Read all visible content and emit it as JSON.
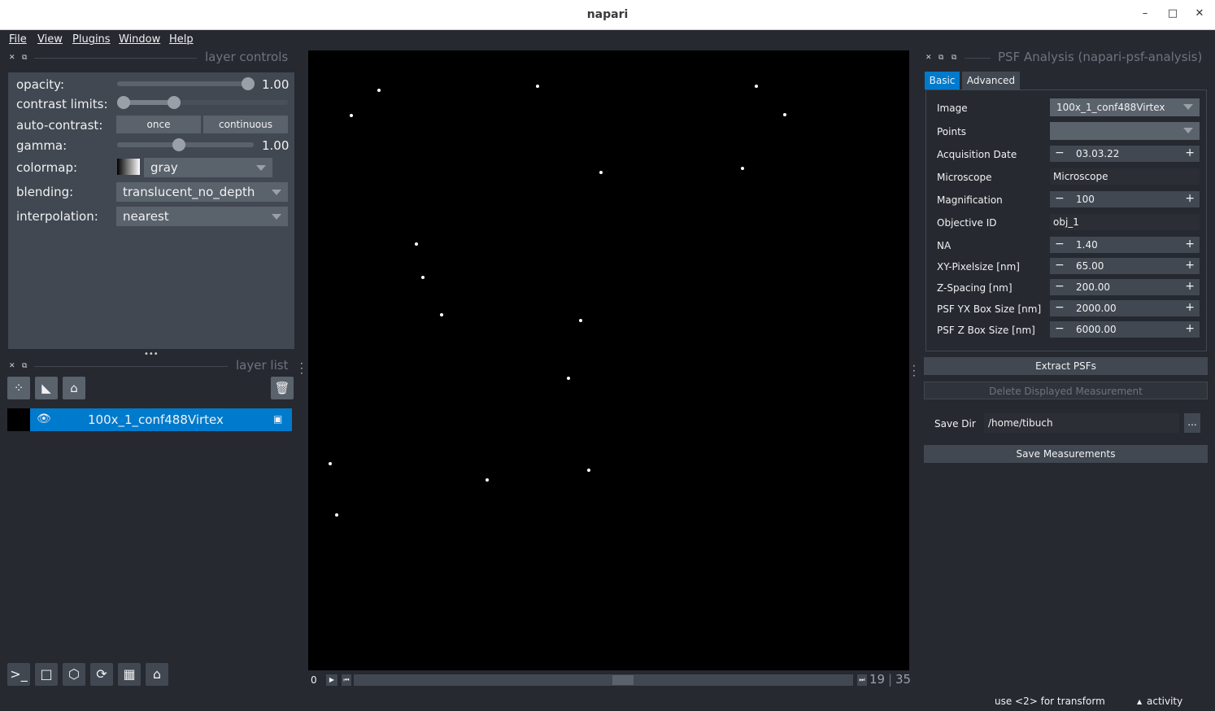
{
  "window": {
    "title": "napari"
  },
  "menu": [
    "File",
    "View",
    "Plugins",
    "Window",
    "Help"
  ],
  "layer_controls": {
    "title": "layer controls",
    "opacity_label": "opacity:",
    "opacity_value": "1.00",
    "contrast_label": "contrast limits:",
    "auto_contrast_label": "auto-contrast:",
    "once_label": "once",
    "continuous_label": "continuous",
    "gamma_label": "gamma:",
    "gamma_value": "1.00",
    "colormap_label": "colormap:",
    "colormap_value": "gray",
    "blending_label": "blending:",
    "blending_value": "translucent_no_depth",
    "interpolation_label": "interpolation:",
    "interpolation_value": "nearest"
  },
  "layer_list": {
    "title": "layer list",
    "layers": [
      {
        "name": "100x_1_conf488Virtex"
      }
    ]
  },
  "dims": {
    "start": "0",
    "current": "19",
    "total": "35",
    "position_fraction": 0.54
  },
  "plugin": {
    "title": "PSF Analysis (napari-psf-analysis)",
    "tabs": [
      "Basic",
      "Advanced"
    ],
    "fields": {
      "image_label": "Image",
      "image_value": "100x_1_conf488Virtex",
      "points_label": "Points",
      "points_value": "",
      "date_label": "Acquisition Date",
      "date_value": "03.03.22",
      "microscope_label": "Microscope",
      "microscope_value": "Microscope",
      "magnification_label": "Magnification",
      "magnification_value": "100",
      "objective_label": "Objective ID",
      "objective_value": "obj_1",
      "na_label": "NA",
      "na_value": "1.40",
      "xy_label": "XY-Pixelsize [nm]",
      "xy_value": "65.00",
      "z_label": "Z-Spacing [nm]",
      "z_value": "200.00",
      "yxbox_label": "PSF YX Box Size [nm]",
      "yxbox_value": "2000.00",
      "zbox_label": "PSF Z Box Size [nm]",
      "zbox_value": "6000.00"
    },
    "extract_label": "Extract PSFs",
    "delete_label": "Delete Displayed Measurement",
    "save_dir_label": "Save Dir",
    "save_dir_value": "/home/tibuch",
    "browse_label": "...",
    "save_label": "Save Measurements"
  },
  "status": {
    "hint": "use <2> for transform",
    "activity": "activity"
  }
}
